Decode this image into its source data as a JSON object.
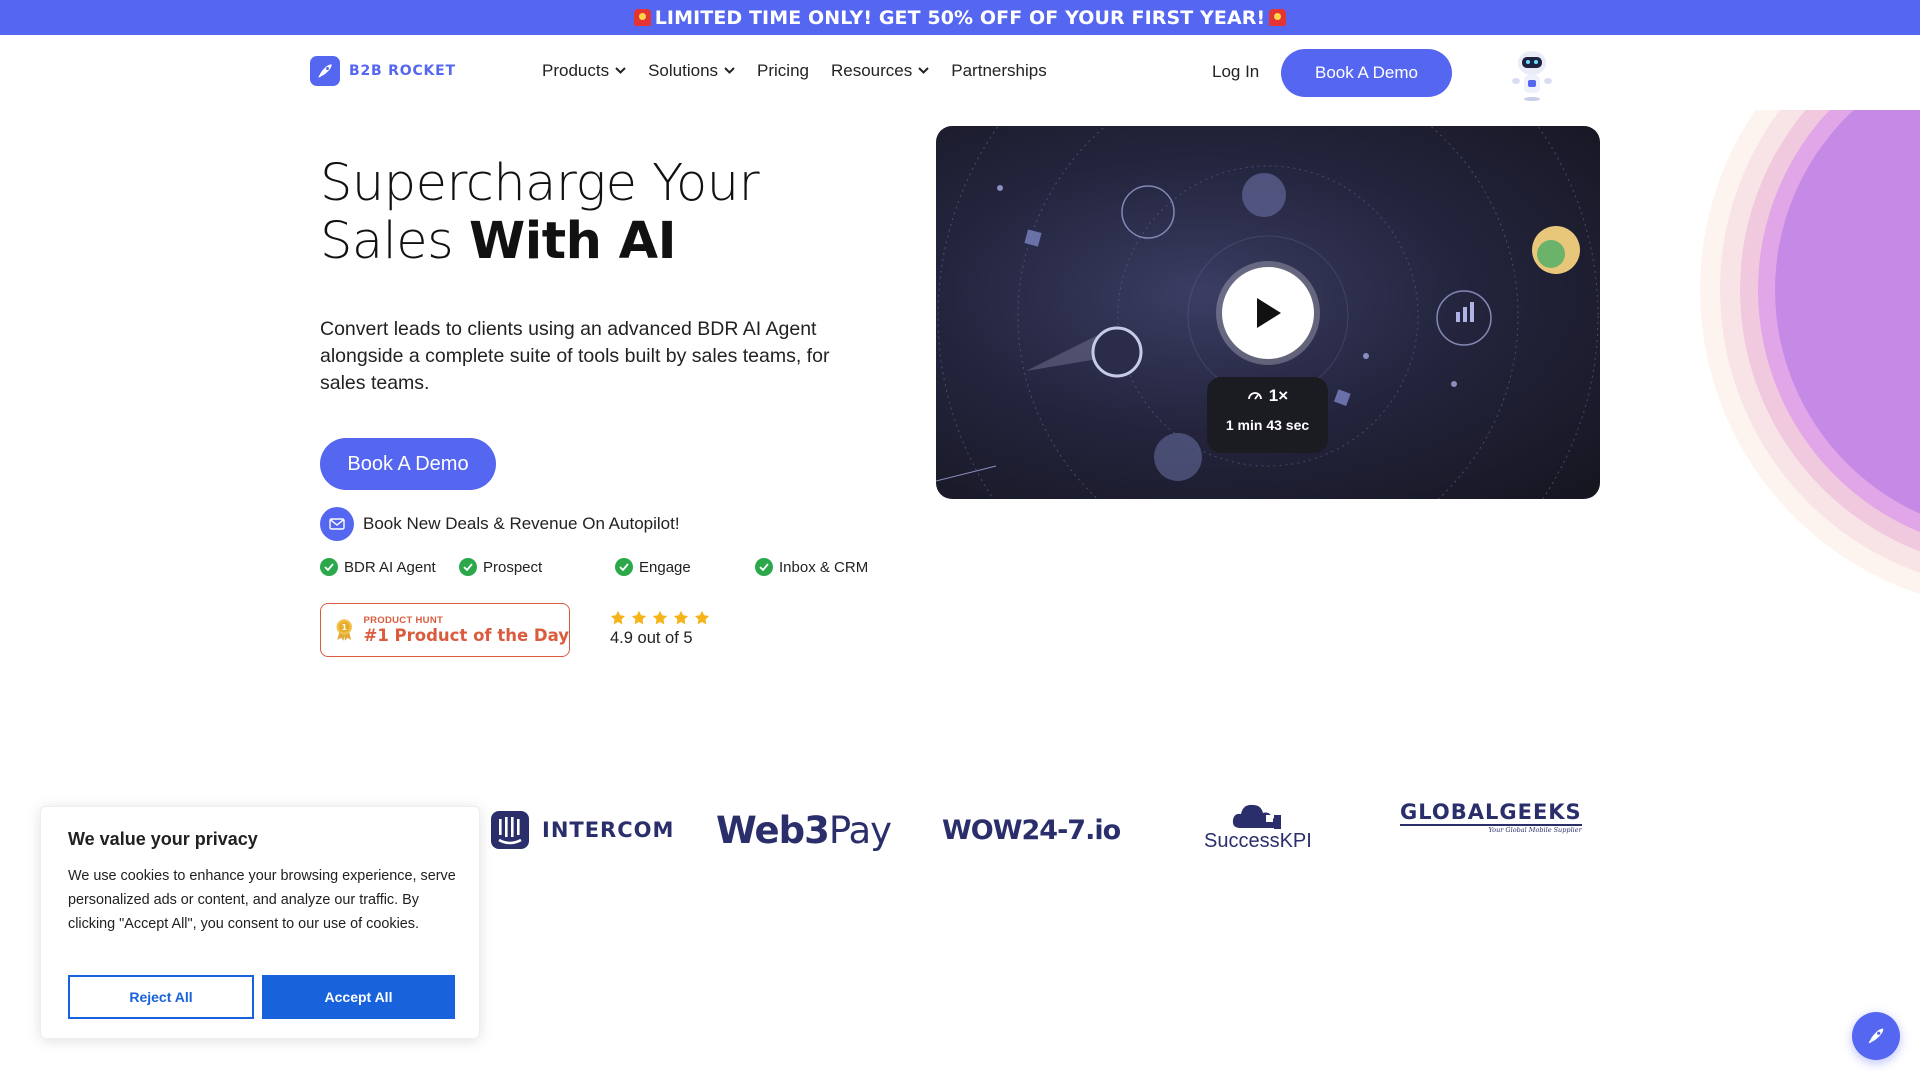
{
  "promo": {
    "text": "LIMITED TIME ONLY! GET 50% OFF OF YOUR FIRST YEAR!"
  },
  "brand": {
    "name": "B2B ROCKET",
    "accent": "#5566f0"
  },
  "nav": {
    "items": [
      {
        "label": "Products",
        "dropdown": true
      },
      {
        "label": "Solutions",
        "dropdown": true
      },
      {
        "label": "Pricing",
        "dropdown": false
      },
      {
        "label": "Resources",
        "dropdown": true
      },
      {
        "label": "Partnerships",
        "dropdown": false
      }
    ],
    "login": "Log In",
    "cta": "Book A Demo"
  },
  "hero": {
    "title_light_1": "Supercharge Your",
    "title_light_2": "Sales ",
    "title_bold": "With AI",
    "description": "Convert leads to clients using an advanced BDR AI Agent alongside a complete suite of tools built by sales teams, for sales teams.",
    "cta": "Book A Demo",
    "autopilot": "Book New Deals & Revenue On Autopilot!",
    "features": [
      "BDR AI Agent",
      "Prospect",
      "Engage",
      "Inbox & CRM"
    ],
    "product_hunt": {
      "label": "PRODUCT HUNT",
      "title": "#1 Product of the Day"
    },
    "rating": {
      "stars": 5,
      "text": "4.9 out of 5"
    }
  },
  "video": {
    "speed": "1×",
    "duration": "1 min 43 sec"
  },
  "logos": {
    "intercom": "INTERCOM",
    "web3pay_a": "Web3",
    "web3pay_b": "Pay",
    "wow": "WOW24-7.io",
    "successkpi": "SuccessKPI",
    "globalgeeks": "GLOBALGEEKS",
    "globalgeeks_sub": "Your Global Mobile Supplier"
  },
  "cookie": {
    "title": "We value your privacy",
    "text": "We use cookies to enhance your browsing experience, serve personalized ads or content, and analyze our traffic. By clicking \"Accept All\", you consent to our use of cookies.",
    "reject": "Reject All",
    "accept": "Accept All"
  }
}
